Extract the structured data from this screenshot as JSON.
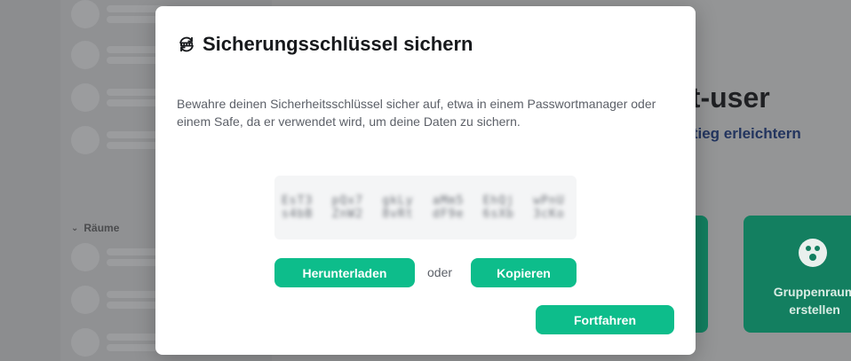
{
  "background": {
    "rooms_header": "Räume",
    "title_fragment": "st-user",
    "subtitle_fragment": "nstieg erleichtern",
    "card_two_label": "Gruppenraum erstellen"
  },
  "dialog": {
    "title": "Sicherungsschlüssel sichern",
    "description": "Bewahre deinen Sicherheitsschlüssel sicher auf, etwa in einem Passwortmanager oder einem Safe, da er verwendet wird, um deine Daten zu sichern.",
    "key_groups": [
      "EsT3 s4bB",
      "pQx7 ZnW2",
      "gkLy 8vRt",
      "aMm5 dF9e",
      "EhQj 6sXb",
      "wPnU 3cKo"
    ],
    "download_label": "Herunterladen",
    "or_label": "oder",
    "copy_label": "Kopieren",
    "continue_label": "Fortfahren"
  },
  "colors": {
    "accent": "#0dbd8b",
    "card_bg_dimmed": "#137f60"
  },
  "icons": {
    "dialog_icon": "key-backup-icon",
    "rooms_chevron": "chevron-down-icon",
    "card_icon": "group-icon"
  }
}
